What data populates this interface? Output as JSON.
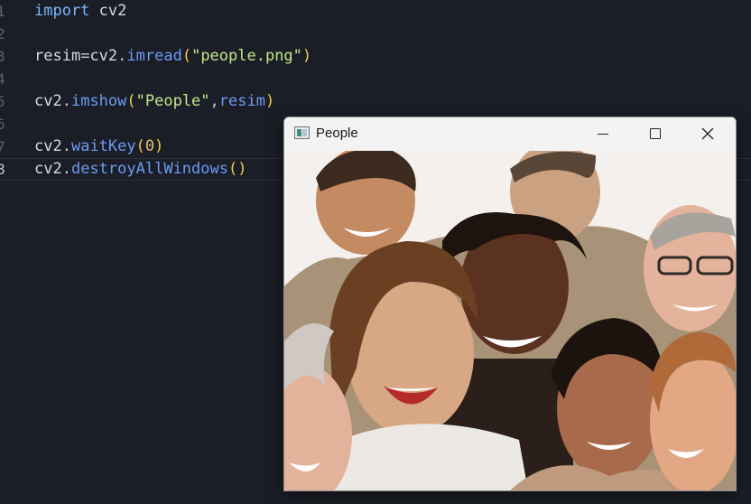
{
  "editor": {
    "lines": [
      {
        "no": "1"
      },
      {
        "no": "2"
      },
      {
        "no": "3"
      },
      {
        "no": "4"
      },
      {
        "no": "5"
      },
      {
        "no": "6"
      },
      {
        "no": "7"
      },
      {
        "no": "8"
      }
    ],
    "tokens": {
      "l1_kw": "import",
      "l1_mod": "cv2",
      "l3_var": "resim",
      "l3_eq": "=",
      "l3_mod": "cv2",
      "l3_dot": ".",
      "l3_fn": "imread",
      "l3_open": "(",
      "l3_str": "\"people.png\"",
      "l3_close": ")",
      "l5_mod": "cv2",
      "l5_dot": ".",
      "l5_fn": "imshow",
      "l5_open": "(",
      "l5_str": "\"People\"",
      "l5_comma": ",",
      "l5_arg": "resim",
      "l5_close": ")",
      "l7_mod": "cv2",
      "l7_dot": ".",
      "l7_fn": "waitKey",
      "l7_open": "(",
      "l7_num": "0",
      "l7_close": ")",
      "l8_mod": "cv2",
      "l8_dot": ".",
      "l8_fn": "destroyAllWindows",
      "l8_parens": "()"
    }
  },
  "window": {
    "title": "People",
    "image": "photo of a group of laughing people",
    "buttons": {
      "minimize": "minimize",
      "maximize": "maximize",
      "close": "close"
    }
  }
}
